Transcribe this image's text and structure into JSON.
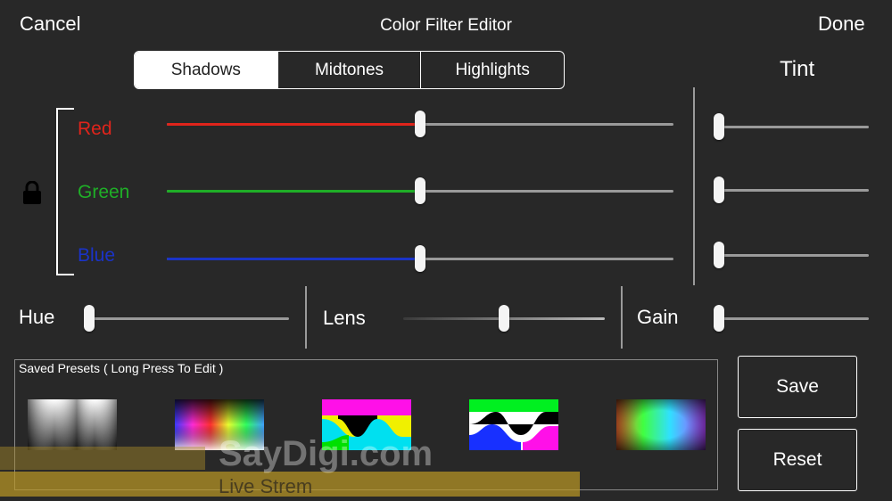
{
  "nav": {
    "cancel": "Cancel",
    "title": "Color Filter Editor",
    "done": "Done"
  },
  "tabs": [
    {
      "label": "Shadows",
      "active": true
    },
    {
      "label": "Midtones",
      "active": false
    },
    {
      "label": "Highlights",
      "active": false
    }
  ],
  "tint": {
    "title": "Tint",
    "red": 0,
    "green": 0,
    "blue": 0
  },
  "channels": {
    "lock_icon": "lock-icon",
    "red": {
      "label": "Red",
      "color": "#e0241b",
      "value": 0.5
    },
    "green": {
      "label": "Green",
      "color": "#1fae27",
      "value": 0.5
    },
    "blue": {
      "label": "Blue",
      "color": "#1a33c8",
      "value": 0.5
    }
  },
  "adjust": {
    "hue": {
      "label": "Hue",
      "value": 0
    },
    "lens": {
      "label": "Lens",
      "value": 0.5
    },
    "gain": {
      "label": "Gain",
      "value": 0
    }
  },
  "presets": {
    "title": "Saved Presets ( Long Press To Edit )",
    "count": 5
  },
  "actions": {
    "save": "Save",
    "reset": "Reset"
  },
  "watermark": {
    "brand": "SayDigi.com",
    "tagline": "Live Strem"
  }
}
